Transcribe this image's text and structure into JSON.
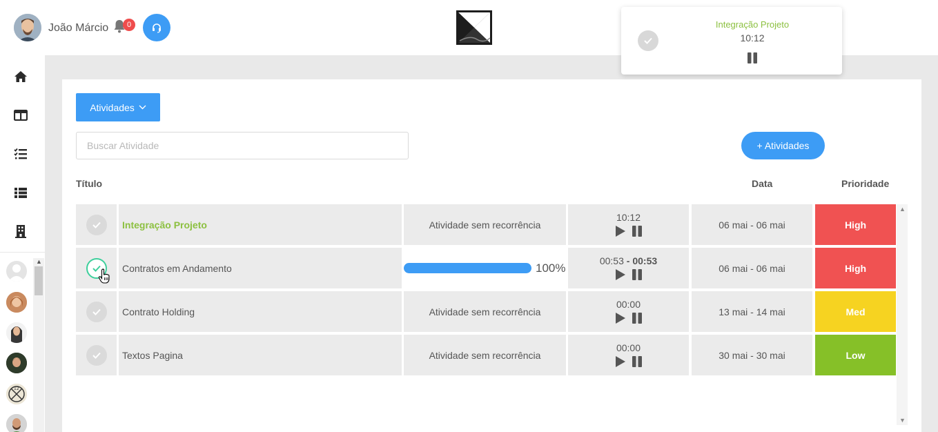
{
  "header": {
    "user_name": "João Márcio",
    "notification_count": "0"
  },
  "timer_card": {
    "title": "Integração Projeto",
    "time": "10:12"
  },
  "toolbar": {
    "activities_dropdown_label": "Atividades",
    "search_placeholder": "Buscar Atividade",
    "add_activity_label": "+ Atividades"
  },
  "table": {
    "headers": {
      "title": "Título",
      "date": "Data",
      "priority": "Prioridade"
    },
    "rows": [
      {
        "title": "Integração Projeto",
        "recurrence": "Atividade sem recorrência",
        "time": "10:12",
        "date": "06 mai - 06 mai",
        "priority": "High",
        "priority_color": "#f05252"
      },
      {
        "title": "Contratos em Andamento",
        "progress_percent": 100,
        "progress_label": "100%",
        "time_elapsed": "00:53",
        "time_total": "- 00:53",
        "date": "06 mai - 06 mai",
        "priority": "High",
        "priority_color": "#f05252"
      },
      {
        "title": "Contrato Holding",
        "recurrence": "Atividade sem recorrência",
        "time": "00:00",
        "date": "13 mai - 14 mai",
        "priority": "Med",
        "priority_color": "#f6d321"
      },
      {
        "title": "Textos Pagina",
        "recurrence": "Atividade sem recorrência",
        "time": "00:00",
        "date": "30 mai - 30 mai",
        "priority": "Low",
        "priority_color": "#86c028"
      }
    ]
  },
  "sidebar": {
    "items": [
      "home-icon",
      "columns-icon",
      "checklist-icon",
      "list-icon",
      "building-icon"
    ]
  },
  "colors": {
    "accent": "#3d9cf5",
    "highlight_green": "#8cc040",
    "high": "#f05252",
    "med": "#f6d321",
    "low": "#86c028"
  }
}
